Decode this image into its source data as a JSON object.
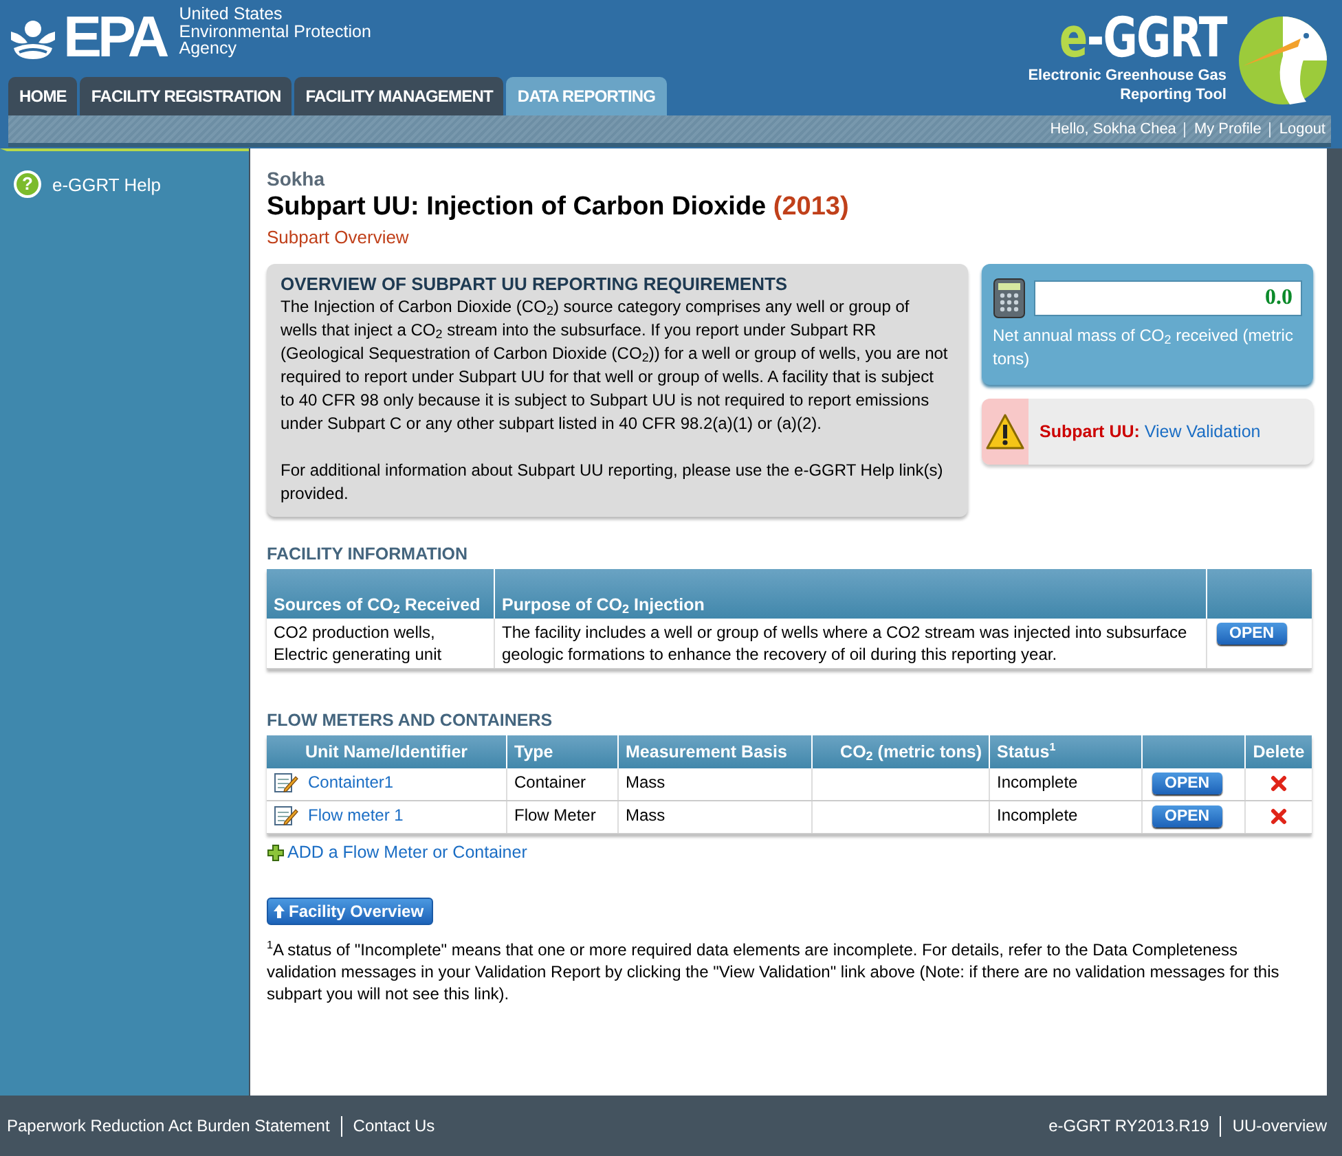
{
  "header": {
    "agency_mark": "EPA",
    "agency_name": [
      "United States",
      "Environmental Protection",
      "Agency"
    ],
    "app_logo": {
      "accent": "e",
      "name": "-GGRT"
    },
    "app_subtitle": [
      "Electronic Greenhouse Gas",
      "Reporting Tool"
    ]
  },
  "tabs": [
    {
      "label": "HOME",
      "selected": false
    },
    {
      "label": "FACILITY REGISTRATION",
      "selected": false
    },
    {
      "label": "FACILITY MANAGEMENT",
      "selected": false
    },
    {
      "label": "DATA REPORTING",
      "selected": true
    }
  ],
  "user_links": [
    "Hello, Sokha Chea",
    "My Profile",
    "Logout"
  ],
  "sidebar": {
    "items": [
      {
        "icon_glyph": "?",
        "label": "e-GGRT Help"
      }
    ]
  },
  "facility_name": "Sokha",
  "title": "Subpart UU: Injection of Carbon Dioxide",
  "year": "(2013)",
  "subtitle": "Subpart Overview",
  "overview": {
    "heading": "OVERVIEW OF SUBPART UU REPORTING REQUIREMENTS",
    "paragraphs": [
      "The Injection of Carbon Dioxide (CO$_{2}$) source category comprises any well or group of wells that inject a CO$_{2}$ stream into the subsurface. If you report under Subpart RR (Geological Sequestration of Carbon Dioxide (CO$_{2}$)) for a well or group of wells, you are not required to report under Subpart UU for that well or group of wells. A facility that is subject to 40 CFR 98 only because it is subject to Subpart UU is not required to report emissions under Subpart C or any other subpart listed in 40 CFR 98.2(a)(1) or (a)(2).",
      "For additional information about Subpart UU reporting, please use the e-GGRT Help link(s) provided."
    ]
  },
  "net_mass": {
    "value": "0.0",
    "label": "Net annual mass of CO$_{2}$ received (metric tons)"
  },
  "validation": {
    "label": "Subpart UU:",
    "link": "View Validation"
  },
  "facility_info": {
    "heading": "FACILITY INFORMATION",
    "columns": [
      "Sources of CO$_{2}$ Received",
      "Purpose of CO$_{2}$ Injection"
    ],
    "rows": [
      {
        "sources": "CO2 production wells, Electric generating unit",
        "purpose": "The facility includes a well or group of wells where a CO2 stream was injected into subsurface geologic formations to enhance the recovery of oil during this reporting year.",
        "action": "OPEN"
      }
    ]
  },
  "flow_meters": {
    "heading": "FLOW METERS AND CONTAINERS",
    "columns": [
      "Unit Name/Identifier",
      "Type",
      "Measurement Basis",
      "CO$_{2}$ (metric tons)",
      "Status$^{1}$",
      "Delete"
    ],
    "rows": [
      {
        "name": "Containter1",
        "type": "Container",
        "basis": "Mass",
        "status": "Incomplete",
        "action": "OPEN"
      },
      {
        "name": "Flow meter 1",
        "type": "Flow Meter",
        "basis": "Mass",
        "status": "Incomplete",
        "action": "OPEN"
      }
    ]
  },
  "add_link": "ADD a Flow Meter or Container",
  "back_button": "Facility Overview",
  "footnote": "$^{1}$A status of \"Incomplete\" means that one or more required data elements are incomplete. For details, refer to the Data Completeness validation messages in your Validation Report by clicking the \"View Validation\" link above (Note: if there are no validation messages for this subpart you will not see this link).",
  "footer": {
    "left": [
      "Paperwork Reduction Act Burden Statement",
      "Contact Us"
    ],
    "right": [
      "e-GGRT RY2013.R19",
      "UU-overview"
    ]
  }
}
